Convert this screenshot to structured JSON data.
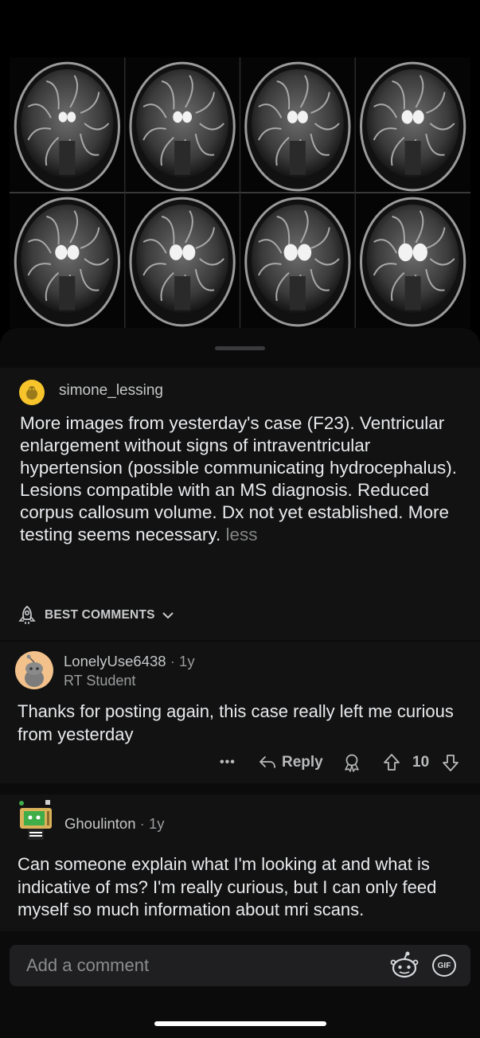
{
  "post": {
    "author": "simone_lessing",
    "body": "More images from yesterday's case (F23). Ventricular enlargement without signs of intraventricular hypertension (possible communicating hydrocephalus). Lesions compatible with an MS diagnosis. Reduced corpus callosum volume. Dx not yet established. More testing seems necessary.",
    "less_link": "less"
  },
  "sort": {
    "label": "BEST COMMENTS"
  },
  "comments": [
    {
      "author": "LonelyUse6438",
      "age": "1y",
      "flair": "RT Student",
      "text": "Thanks for posting again, this case really left me curious from yesterday",
      "actions": {
        "more": "•••",
        "reply": "Reply",
        "votes": "10"
      }
    },
    {
      "author": "Ghoulinton",
      "age": "1y",
      "text": "Can someone explain what I'm looking at and what is indicative of ms? I'm really curious, but I can only feed myself so much information about mri scans."
    }
  ],
  "composer": {
    "placeholder": "Add a comment",
    "gif_label": "GIF",
    "icons": [
      "snoo-emoji-icon",
      "gif-icon"
    ]
  },
  "image": {
    "description_icon": "mri-scan-grid"
  }
}
